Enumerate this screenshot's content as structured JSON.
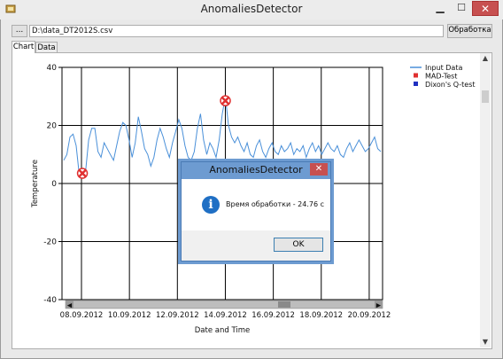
{
  "window": {
    "title": "AnomaliesDetector"
  },
  "toolbar": {
    "browse_label": "...",
    "file_path": "D:\\data_DT2012S.csv",
    "process_label": "Обработка"
  },
  "tabs": [
    {
      "label": "Chart",
      "active": true
    },
    {
      "label": "Data",
      "active": false
    }
  ],
  "chart_data": {
    "type": "line",
    "xlabel": "Date and Time",
    "ylabel": "Temperature",
    "ylim": [
      -40,
      40
    ],
    "yticks": [
      "40",
      "20",
      "0",
      "-20",
      "-40"
    ],
    "xticks": [
      "08.09.2012",
      "10.09.2012",
      "12.09.2012",
      "14.09.2012",
      "16.09.2012",
      "18.09.2012",
      "20.09.2012"
    ],
    "grid": true,
    "legend_position": "top-right",
    "legend": [
      "Input Data",
      "MAD-Test",
      "Dixon's Q-test"
    ],
    "series": [
      {
        "name": "Input Data",
        "color": "#4a90d9",
        "values": [
          8,
          10,
          16,
          17,
          13,
          3,
          2,
          4,
          15,
          19,
          19,
          11,
          9,
          14,
          12,
          10,
          8,
          13,
          18,
          21,
          20,
          15,
          9,
          14,
          23,
          18,
          12,
          10,
          6,
          9,
          15,
          19,
          16,
          12,
          9,
          14,
          18,
          22,
          19,
          13,
          9,
          8,
          11,
          19,
          24,
          15,
          10,
          14,
          12,
          9,
          15,
          24,
          30,
          20,
          16,
          14,
          16,
          13,
          11,
          14,
          10,
          9,
          13,
          15,
          11,
          9,
          12,
          14,
          11,
          10,
          13,
          11,
          12,
          14,
          10,
          12,
          11,
          13,
          9,
          12,
          14,
          11,
          13,
          10,
          12,
          14,
          12,
          11,
          13,
          10,
          9,
          12,
          14,
          11,
          13,
          15,
          13,
          11,
          12,
          14,
          16,
          12,
          11
        ]
      },
      {
        "name": "MAD-Test",
        "color": "#e03030",
        "points": [
          {
            "i": 6,
            "value": 3.5
          },
          {
            "i": 52,
            "value": 28.5
          }
        ]
      },
      {
        "name": "Dixon's Q-test",
        "color": "#2030c0",
        "points": []
      }
    ]
  },
  "dialog": {
    "title": "AnomaliesDetector",
    "message": "Время обработки - 24.76 с",
    "ok_label": "OK",
    "close_glyph": "✕"
  }
}
